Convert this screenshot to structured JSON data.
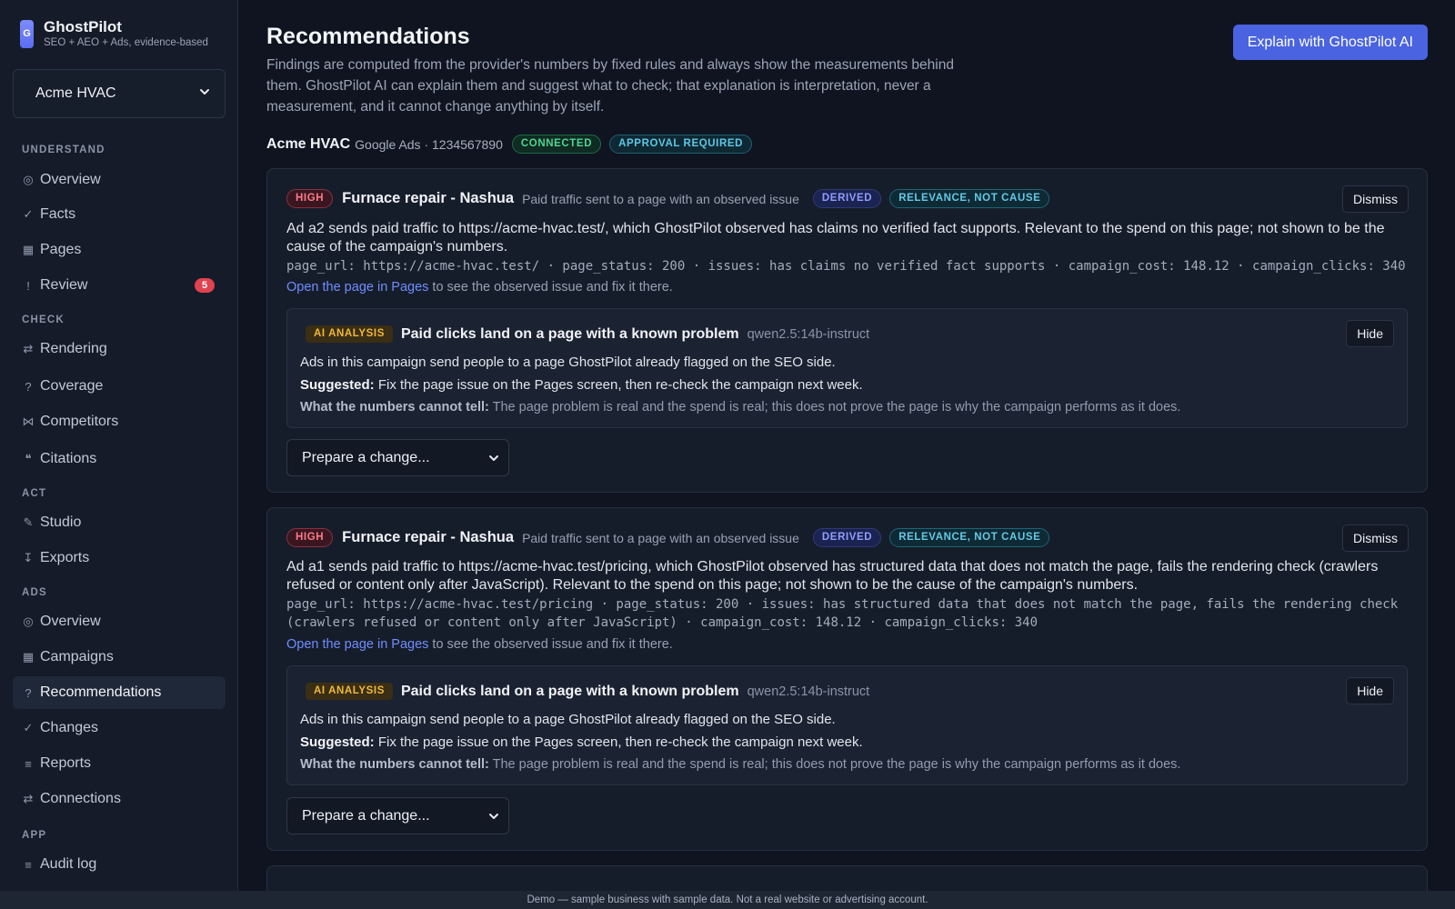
{
  "brand": {
    "logo_letter": "G",
    "name": "GhostPilot",
    "tagline": "SEO + AEO + Ads, evidence-based"
  },
  "account_selector": {
    "value": "Acme HVAC",
    "icon": "chevron-down-icon"
  },
  "sidebar": {
    "sections": {
      "understand": "UNDERSTAND",
      "check": "CHECK",
      "act": "ACT",
      "ads": "ADS",
      "app": "APP"
    },
    "items": {
      "overview": {
        "icon": "◎",
        "label": "Overview"
      },
      "facts": {
        "icon": "✓",
        "label": "Facts"
      },
      "pages": {
        "icon": "▦",
        "label": "Pages"
      },
      "review": {
        "icon": "!",
        "label": "Review",
        "badge": "5"
      },
      "rendering": {
        "icon": "⇄",
        "label": "Rendering"
      },
      "coverage": {
        "icon": "?",
        "label": "Coverage"
      },
      "competitors": {
        "icon": "⋈",
        "label": "Competitors"
      },
      "citations": {
        "icon": "❝",
        "label": "Citations"
      },
      "studio": {
        "icon": "✎",
        "label": "Studio"
      },
      "exports": {
        "icon": "↧",
        "label": "Exports"
      },
      "ads_overview": {
        "icon": "◎",
        "label": "Overview"
      },
      "campaigns": {
        "icon": "▦",
        "label": "Campaigns"
      },
      "recommendations": {
        "icon": "?",
        "label": "Recommendations",
        "active": true
      },
      "changes": {
        "icon": "✓",
        "label": "Changes"
      },
      "reports": {
        "icon": "≡",
        "label": "Reports"
      },
      "connections": {
        "icon": "⇄",
        "label": "Connections"
      },
      "audit_log": {
        "icon": "≡",
        "label": "Audit log"
      }
    }
  },
  "header": {
    "title": "Recommendations",
    "intro": "Findings are computed from the provider's numbers by fixed rules and always show the measurements behind them. GhostPilot AI can explain them and suggest what to check; that explanation is interpretation, never a measurement, and it cannot change anything by itself.",
    "explain_button": "Explain with GhostPilot AI"
  },
  "account_line": {
    "name": "Acme HVAC",
    "detail": "Google Ads · 1234567890",
    "status": "CONNECTED",
    "approval": "APPROVAL REQUIRED"
  },
  "cards": [
    {
      "severity": "HIGH",
      "campaign": "Furnace repair - Nashua",
      "finding_type": "Paid traffic sent to a page with an observed issue",
      "tag_derived": "DERIVED",
      "tag_relevance": "RELEVANCE, NOT CAUSE",
      "dismiss": "Dismiss",
      "summary": "Ad a2 sends paid traffic to https://acme-hvac.test/, which GhostPilot observed has claims no verified fact supports. Relevant to the spend on this page; not shown to be the cause of the campaign's numbers.",
      "measurements": "page_url: https://acme-hvac.test/ · page_status: 200 · issues: has claims no verified fact supports · campaign_cost: 148.12 · campaign_clicks: 340",
      "pages_link": "Open the page in Pages",
      "pages_suffix": " to see the observed issue and fix it there.",
      "ai": {
        "tag": "AI ANALYSIS",
        "title": "Paid clicks land on a page with a known problem",
        "model": "qwen2.5:14b-instruct",
        "hide": "Hide",
        "line1": "Ads in this campaign send people to a page GhostPilot already flagged on the SEO side.",
        "suggested_label": "Suggested:",
        "suggested": " Fix the page issue on the Pages screen, then re-check the campaign next week.",
        "cannot_label": "What the numbers cannot tell:",
        "cannot": " The page problem is real and the spend is real; this does not prove the page is why the campaign performs as it does."
      },
      "prepare": "Prepare a change..."
    },
    {
      "severity": "HIGH",
      "campaign": "Furnace repair - Nashua",
      "finding_type": "Paid traffic sent to a page with an observed issue",
      "tag_derived": "DERIVED",
      "tag_relevance": "RELEVANCE, NOT CAUSE",
      "dismiss": "Dismiss",
      "summary": "Ad a1 sends paid traffic to https://acme-hvac.test/pricing, which GhostPilot observed has structured data that does not match the page, fails the rendering check (crawlers refused or content only after JavaScript). Relevant to the spend on this page; not shown to be the cause of the campaign's numbers.",
      "measurements": "page_url: https://acme-hvac.test/pricing · page_status: 200 · issues: has structured data that does not match the page, fails the rendering check (crawlers refused or content only after JavaScript) · campaign_cost: 148.12 · campaign_clicks: 340",
      "pages_link": "Open the page in Pages",
      "pages_suffix": " to see the observed issue and fix it there.",
      "ai": {
        "tag": "AI ANALYSIS",
        "title": "Paid clicks land on a page with a known problem",
        "model": "qwen2.5:14b-instruct",
        "hide": "Hide",
        "line1": "Ads in this campaign send people to a page GhostPilot already flagged on the SEO side.",
        "suggested_label": "Suggested:",
        "suggested": " Fix the page issue on the Pages screen, then re-check the campaign next week.",
        "cannot_label": "What the numbers cannot tell:",
        "cannot": " The page problem is real and the spend is real; this does not prove the page is why the campaign performs as it does."
      },
      "prepare": "Prepare a change..."
    }
  ],
  "footer": {
    "demo_notice": "Demo — sample business with sample data. Not a real website or advertising account."
  },
  "colors": {
    "accent": "#4a63e0",
    "background": "#0f1420",
    "sidebar": "#151b28",
    "high": "#ff7a8a",
    "ai_tag": "#f0b83c"
  }
}
